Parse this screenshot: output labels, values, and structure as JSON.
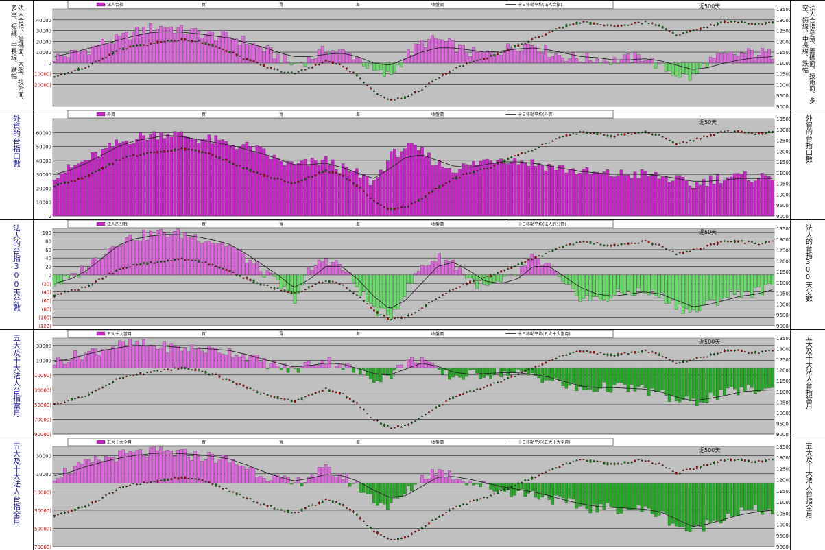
{
  "panels": [
    {
      "left_text": "",
      "right_text": "法人合指參昜、籌碼面、技術面、多空、短線、中長線、跌幅",
      "left_small_text": "法人合指、籌碼面、大盤、技術面、多空、短線、中長線、跌幅",
      "legend": {
        "bar_name": "法人合指",
        "marks": [
          "買",
          "賣",
          "差",
          "收盤價"
        ],
        "line_name": "十日移動平均(法人合指)"
      },
      "period_label": "近500天"
    },
    {
      "left_text": "外資的台指口數",
      "right_text": "外資的台指口數",
      "legend": {
        "bar_name": "外資",
        "marks": [
          "買",
          "賣",
          "差",
          "收盤價"
        ],
        "line_name": "十日移動平均(外資)"
      },
      "period_label": "近50天"
    },
    {
      "left_text": "法人的台指300天分數",
      "right_text": "法人的台指300天分數",
      "legend": {
        "bar_name": "法人的分數",
        "marks": [
          "買",
          "賣",
          "差",
          "收盤價"
        ],
        "line_name": "十日移動平均(法人的分數)"
      },
      "period_label": "近50天"
    },
    {
      "left_text": "五大及十大法人台指當月",
      "right_text": "五大及十大法人台指當月",
      "legend": {
        "bar_name": "五大十大當月",
        "marks": [
          "買",
          "賣",
          "差",
          "收盤價"
        ],
        "line_name": "十日移動平均(五大十大當月)"
      },
      "period_label": "近500天"
    },
    {
      "left_text": "五大及十大法人台指全月",
      "right_text": "五大及十大法人台指全月",
      "legend": {
        "bar_name": "五大十大全月",
        "marks": [
          "買",
          "賣",
          "差",
          "收盤價"
        ],
        "line_name": "十日移動平均(五大十大全月)"
      },
      "period_label": "近500天"
    }
  ],
  "colors": {
    "plot_bg": "#c0c0c0",
    "positive_bar": "#e066e0",
    "positive_bar_strong": "#cc22cc",
    "negative_bar": "#66dd66",
    "negative_bar_strong": "#22aa22",
    "price": "#000000",
    "candle_up": "#cc0000",
    "candle_down": "#007700",
    "negative_tick": "#cc0000"
  },
  "chart_data": [
    {
      "type": "bar",
      "title": "",
      "ylim_left": [
        -40000,
        50000
      ],
      "left_ticks": [
        "40000",
        "30000",
        "20000",
        "10000",
        "0",
        "(10000)",
        "(20000)"
      ],
      "ylim_right": [
        9000,
        13500
      ],
      "right_ticks": [
        "13500",
        "13000",
        "12500",
        "12000",
        "11500",
        "11000",
        "10500",
        "10000",
        "9500",
        "9000"
      ],
      "series": [
        {
          "kind": "bars",
          "values_sampled": [
            5000,
            8000,
            12000,
            18000,
            22000,
            28000,
            32000,
            34000,
            30000,
            28000,
            26000,
            24000,
            20000,
            14000,
            6000,
            -2000,
            4000,
            12000,
            10000,
            6000,
            -8000,
            -12000,
            6000,
            18000,
            22000,
            16000,
            10000,
            8000,
            12000,
            16000,
            18000,
            10000,
            6000,
            4000,
            4000,
            2000,
            4000,
            6000,
            -4000,
            -10000,
            -14000,
            2000,
            6000,
            8000,
            10000,
            8000
          ]
        },
        {
          "kind": "moving_average",
          "values_sampled": [
            6000,
            9000,
            13000,
            17000,
            21000,
            25000,
            28000,
            29000,
            28500,
            27000,
            25000,
            23000,
            19000,
            15000,
            10000,
            6000,
            6000,
            8000,
            9000,
            6000,
            0,
            -2000,
            4000,
            10000,
            14000,
            14000,
            12000,
            10000,
            11000,
            13000,
            14000,
            12000,
            9000,
            6000,
            5000,
            3000,
            3000,
            4000,
            2000,
            -2000,
            -6000,
            -4000,
            0,
            3000,
            5000,
            6000
          ]
        },
        {
          "kind": "price",
          "values_sampled": [
            10400,
            10600,
            10800,
            11200,
            11600,
            11800,
            11900,
            12000,
            12100,
            12000,
            11800,
            11500,
            11200,
            10900,
            10700,
            10500,
            10800,
            11100,
            10900,
            10400,
            9700,
            9300,
            9400,
            9800,
            10300,
            10700,
            11000,
            11200,
            11500,
            11800,
            12100,
            12400,
            12700,
            12900,
            12800,
            12700,
            12800,
            12900,
            12700,
            12300,
            12500,
            12700,
            12900,
            12900,
            12800,
            12900
          ]
        }
      ]
    },
    {
      "type": "bar",
      "title": "",
      "ylim_left": [
        0,
        70000
      ],
      "left_ticks": [
        "60000",
        "50000",
        "40000",
        "30000",
        "20000",
        "10000",
        "0"
      ],
      "ylim_right": [
        9000,
        13500
      ],
      "right_ticks": [
        "13500",
        "13000",
        "12500",
        "12000",
        "11500",
        "11000",
        "10500",
        "10000",
        "9500",
        "9000"
      ],
      "series": [
        {
          "kind": "bars",
          "values_sampled": [
            30000,
            34000,
            40000,
            46000,
            52000,
            56000,
            58000,
            60000,
            58000,
            56000,
            54000,
            52000,
            50000,
            46000,
            40000,
            36000,
            38000,
            40000,
            34000,
            30000,
            24000,
            42000,
            50000,
            46000,
            38000,
            34000,
            36000,
            40000,
            42000,
            40000,
            38000,
            36000,
            34000,
            32000,
            30000,
            30000,
            30000,
            30000,
            28000,
            26000,
            22000,
            26000,
            28000,
            28000,
            28000,
            28000
          ]
        },
        {
          "kind": "moving_average",
          "values_sampled": [
            30000,
            33000,
            38000,
            44000,
            50000,
            54000,
            56000,
            58000,
            57000,
            55000,
            53000,
            51000,
            48000,
            45000,
            41000,
            37000,
            37000,
            38000,
            35000,
            31000,
            27000,
            34000,
            42000,
            44000,
            40000,
            36000,
            35000,
            37000,
            39000,
            39000,
            38000,
            36000,
            34000,
            32000,
            31000,
            30000,
            30000,
            30000,
            29000,
            27000,
            25000,
            25000,
            26000,
            27000,
            27000,
            27000
          ]
        },
        {
          "kind": "price",
          "values_sampled": [
            10400,
            10600,
            10800,
            11200,
            11600,
            11800,
            11900,
            12000,
            12100,
            12000,
            11800,
            11500,
            11200,
            10900,
            10700,
            10500,
            10800,
            11100,
            10900,
            10400,
            9700,
            9300,
            9400,
            9800,
            10300,
            10700,
            11000,
            11200,
            11500,
            11800,
            12100,
            12400,
            12700,
            12900,
            12800,
            12700,
            12800,
            12900,
            12700,
            12300,
            12500,
            12700,
            12900,
            12900,
            12800,
            12900
          ]
        }
      ]
    },
    {
      "type": "bar",
      "title": "",
      "ylim_left": [
        -120,
        110
      ],
      "left_ticks": [
        "100",
        "80",
        "60",
        "40",
        "20",
        "0",
        "(20)",
        "(40)",
        "(60)",
        "(80)",
        "(100)",
        "(120)"
      ],
      "ylim_right": [
        9000,
        13500
      ],
      "right_ticks": [
        "13500",
        "13000",
        "12500",
        "12000",
        "11500",
        "11000",
        "10500",
        "10000",
        "9500",
        "9000"
      ],
      "series": [
        {
          "kind": "bars",
          "values_sampled": [
            -20,
            -10,
            20,
            50,
            80,
            90,
            95,
            100,
            96,
            90,
            80,
            70,
            40,
            10,
            -20,
            -60,
            10,
            40,
            20,
            -30,
            -80,
            -100,
            -40,
            20,
            40,
            30,
            -10,
            -30,
            -20,
            0,
            40,
            20,
            -30,
            -50,
            -60,
            -50,
            -40,
            -40,
            -50,
            -70,
            -90,
            -70,
            -50,
            -40,
            -40,
            -30
          ]
        },
        {
          "kind": "moving_average",
          "values_sampled": [
            -20,
            -10,
            10,
            40,
            70,
            85,
            92,
            96,
            95,
            90,
            82,
            72,
            50,
            25,
            0,
            -30,
            -10,
            20,
            20,
            -10,
            -50,
            -80,
            -60,
            -20,
            20,
            30,
            10,
            -15,
            -20,
            -10,
            20,
            20,
            -5,
            -30,
            -45,
            -50,
            -45,
            -40,
            -45,
            -60,
            -75,
            -70,
            -60,
            -50,
            -45,
            -35
          ]
        },
        {
          "kind": "price",
          "values_sampled": [
            10400,
            10600,
            10800,
            11200,
            11600,
            11800,
            11900,
            12000,
            12100,
            12000,
            11800,
            11500,
            11200,
            10900,
            10700,
            10500,
            10800,
            11100,
            10900,
            10400,
            9700,
            9300,
            9400,
            9800,
            10300,
            10700,
            11000,
            11200,
            11500,
            11800,
            12100,
            12400,
            12700,
            12900,
            12800,
            12700,
            12800,
            12900,
            12700,
            12300,
            12500,
            12700,
            12900,
            12900,
            12800,
            12900
          ]
        }
      ]
    },
    {
      "type": "bar",
      "title": "",
      "ylim_left": [
        -90000,
        40000
      ],
      "left_ticks": [
        "30000",
        "10000",
        "(10000)",
        "(30000)",
        "(50000)",
        "(70000)",
        "(90000)"
      ],
      "ylim_right": [
        9000,
        13500
      ],
      "right_ticks": [
        "13500",
        "13000",
        "12500",
        "12000",
        "11500",
        "11000",
        "10500",
        "10000",
        "9500",
        "9000"
      ],
      "series": [
        {
          "kind": "bars",
          "values_sampled": [
            8000,
            14000,
            20000,
            26000,
            30000,
            32000,
            30000,
            28000,
            26000,
            26000,
            24000,
            22000,
            16000,
            8000,
            2000,
            -4000,
            6000,
            10000,
            4000,
            -6000,
            -14000,
            -10000,
            6000,
            14000,
            -6000,
            -12000,
            -10000,
            -8000,
            -6000,
            -8000,
            -10000,
            -16000,
            -24000,
            -30000,
            -28000,
            -26000,
            -28000,
            -30000,
            -36000,
            -44000,
            -48000,
            -40000,
            -36000,
            -30000,
            -30000,
            -30000
          ]
        },
        {
          "kind": "moving_average",
          "values_sampled": [
            8000,
            12000,
            18000,
            23000,
            27000,
            30000,
            30000,
            29000,
            27000,
            26000,
            25000,
            23000,
            18000,
            12000,
            6000,
            1000,
            3000,
            6000,
            5000,
            -1000,
            -8000,
            -10000,
            -2000,
            6000,
            2000,
            -6000,
            -9000,
            -8000,
            -7000,
            -7000,
            -9000,
            -13000,
            -19000,
            -25000,
            -27000,
            -27000,
            -28000,
            -29000,
            -33000,
            -40000,
            -45000,
            -42000,
            -38000,
            -33000,
            -31000,
            -30000
          ]
        },
        {
          "kind": "price",
          "values_sampled": [
            10400,
            10600,
            10800,
            11200,
            11600,
            11800,
            11900,
            12000,
            12100,
            12000,
            11800,
            11500,
            11200,
            10900,
            10700,
            10500,
            10800,
            11100,
            10900,
            10400,
            9700,
            9300,
            9400,
            9800,
            10300,
            10700,
            11000,
            11200,
            11500,
            11800,
            12100,
            12400,
            12700,
            12900,
            12800,
            12700,
            12800,
            12900,
            12700,
            12300,
            12500,
            12700,
            12900,
            12900,
            12800,
            12900
          ]
        }
      ]
    },
    {
      "type": "bar",
      "title": "",
      "ylim_left": [
        -70000,
        40000
      ],
      "left_ticks": [
        "30000",
        "10000",
        "(10000)",
        "(30000)",
        "(50000)",
        "(70000)"
      ],
      "ylim_right": [
        9000,
        13500
      ],
      "right_ticks": [
        "13500",
        "13000",
        "12500",
        "12000",
        "11500",
        "11000",
        "10500",
        "10000",
        "9500",
        "9000"
      ],
      "series": [
        {
          "kind": "bars",
          "values_sampled": [
            8000,
            14000,
            20000,
            26000,
            30000,
            32000,
            33000,
            34000,
            32000,
            30000,
            28000,
            24000,
            18000,
            10000,
            4000,
            -2000,
            8000,
            14000,
            8000,
            -4000,
            -18000,
            -26000,
            -12000,
            6000,
            14000,
            8000,
            2000,
            -4000,
            -8000,
            -10000,
            -12000,
            -16000,
            -22000,
            -26000,
            -28000,
            -28000,
            -28000,
            -30000,
            -34000,
            -46000,
            -54000,
            -44000,
            -36000,
            -32000,
            -30000,
            -30000
          ]
        },
        {
          "kind": "moving_average",
          "values_sampled": [
            8000,
            12000,
            18000,
            23000,
            27000,
            30000,
            32000,
            33000,
            32000,
            31000,
            29000,
            26000,
            20000,
            13000,
            7000,
            2000,
            5000,
            9000,
            8000,
            2000,
            -8000,
            -16000,
            -14000,
            -4000,
            6000,
            7000,
            4000,
            0,
            -4000,
            -7000,
            -10000,
            -14000,
            -19000,
            -23000,
            -26000,
            -27000,
            -28000,
            -29000,
            -32000,
            -40000,
            -48000,
            -45000,
            -40000,
            -35000,
            -32000,
            -30000
          ]
        },
        {
          "kind": "price",
          "values_sampled": [
            10400,
            10600,
            10800,
            11200,
            11600,
            11800,
            11900,
            12000,
            12100,
            12000,
            11800,
            11500,
            11200,
            10900,
            10700,
            10500,
            10800,
            11100,
            10900,
            10400,
            9700,
            9300,
            9400,
            9800,
            10300,
            10700,
            11000,
            11200,
            11500,
            11800,
            12100,
            12400,
            12700,
            12900,
            12800,
            12700,
            12800,
            12900,
            12700,
            12300,
            12500,
            12700,
            12900,
            12900,
            12800,
            12900
          ]
        }
      ]
    }
  ]
}
